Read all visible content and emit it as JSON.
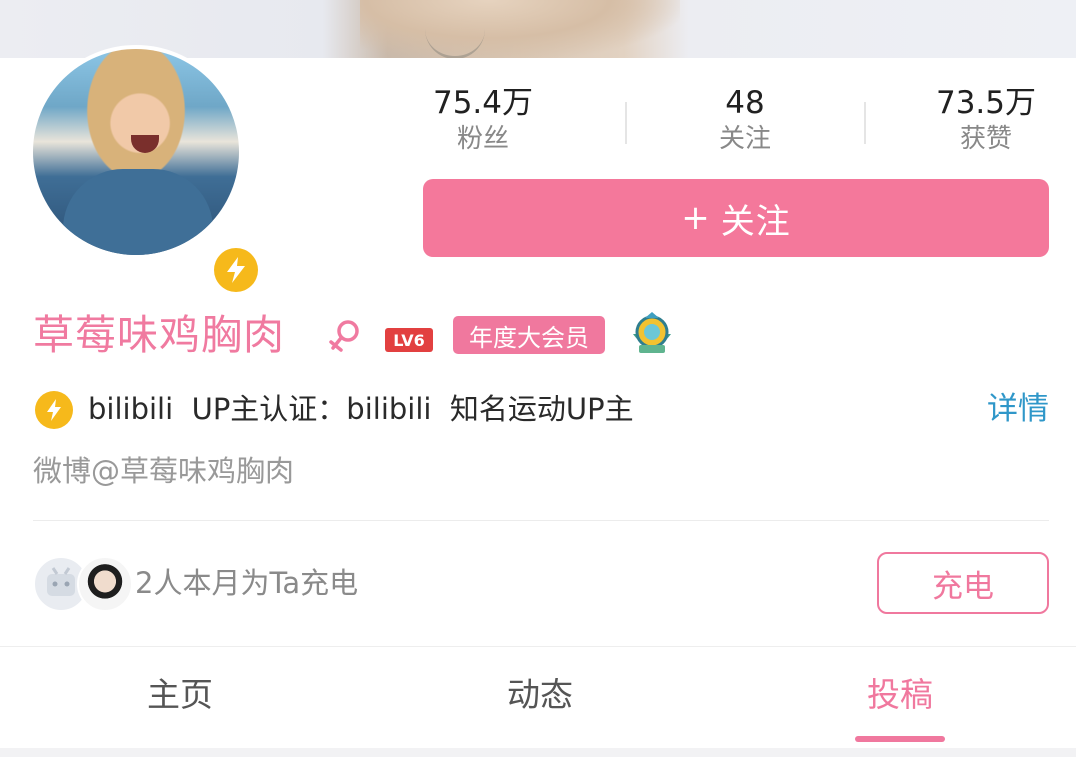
{
  "profile": {
    "name": "草莓味鸡胸肉",
    "level": "LV6",
    "vip_label": "年度大会员",
    "certification_text": "bilibili  UP主认证：bilibili  知名运动UP主",
    "details_link": "详情",
    "bio": "微博@草莓味鸡胸肉"
  },
  "stats": [
    {
      "value": "75.4万",
      "label": "粉丝"
    },
    {
      "value": "48",
      "label": "关注"
    },
    {
      "value": "73.5万",
      "label": "获赞"
    }
  ],
  "follow_button": {
    "icon": "+",
    "label": "关注"
  },
  "charge": {
    "text": "2人本月为Ta充电",
    "button_label": "充电"
  },
  "tabs": [
    {
      "label": "主页",
      "active": false
    },
    {
      "label": "动态",
      "active": false
    },
    {
      "label": "投稿",
      "active": true
    }
  ],
  "colors": {
    "accent_pink": "#f0789e",
    "follow_button": "#f4789b",
    "link_blue": "#2f97c9",
    "badge_gold": "#f6b91b",
    "level_red": "#e24040"
  },
  "icons": {
    "verify_badge": "lightning-bolt-icon",
    "gender": "female-gender-icon",
    "medal": "achievement-medal-icon"
  }
}
